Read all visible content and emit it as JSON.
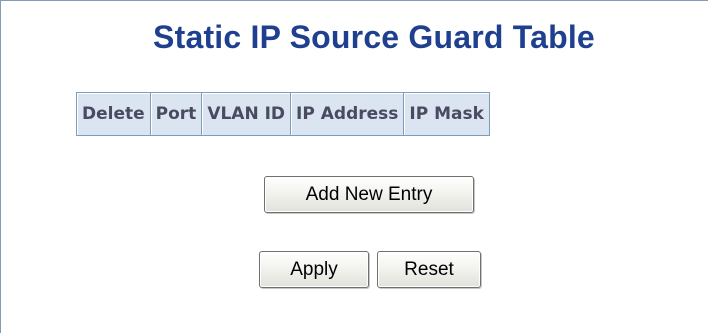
{
  "title": "Static IP Source Guard Table",
  "table": {
    "columns": [
      "Delete",
      "Port",
      "VLAN ID",
      "IP Address",
      "IP Mask"
    ],
    "rows": []
  },
  "buttons": {
    "add_new_entry": "Add New Entry",
    "apply": "Apply",
    "reset": "Reset"
  },
  "colors": {
    "title": "#1f3f8f",
    "header_bg": "#dbe5f1",
    "border": "#7f9db9"
  }
}
